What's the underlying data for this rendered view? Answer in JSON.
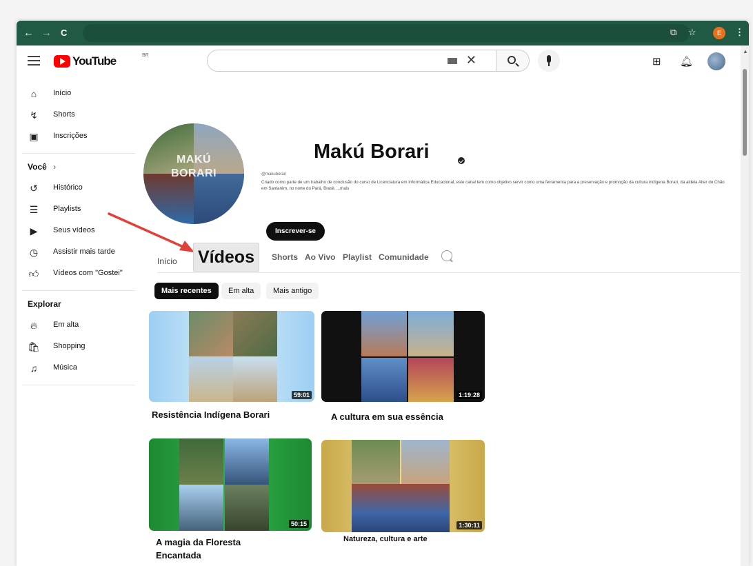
{
  "browser": {
    "back": "←",
    "forward": "→",
    "reload": "C",
    "profile_initial": "E"
  },
  "header": {
    "logo_text": "YouTube",
    "country_code": "BR",
    "search": {
      "value": "",
      "placeholder": ""
    }
  },
  "sidebar": {
    "main": [
      {
        "label": "Início",
        "icon": "home-icon"
      },
      {
        "label": "Shorts",
        "icon": "shorts-icon"
      },
      {
        "label": "Inscrições",
        "icon": "subscriptions-icon"
      }
    ],
    "voce_heading": "Você",
    "voce": [
      {
        "label": "Histórico",
        "icon": "history-icon"
      },
      {
        "label": "Playlists",
        "icon": "playlists-icon"
      },
      {
        "label": "Seus vídeos",
        "icon": "your-videos-icon"
      },
      {
        "label": "Assistir mais tarde",
        "icon": "watch-later-icon"
      },
      {
        "label": "Vídeos com \"Gostei\"",
        "icon": "liked-icon"
      }
    ],
    "explore_heading": "Explorar",
    "explore": [
      {
        "label": "Em alta",
        "icon": "trending-icon"
      },
      {
        "label": "Shopping",
        "icon": "shopping-icon"
      },
      {
        "label": "Música",
        "icon": "music-icon"
      }
    ]
  },
  "channel": {
    "name": "Makú Borari",
    "avatar_text_line1": "MAKÚ",
    "avatar_text_line2": "BORARI",
    "handle": "@makuborari",
    "description": "Criado como parte de um trabalho de conclusão do curso de Licenciatura em Informática Educacional, este canal tem como objetivo servir como uma ferramenta para a preservação e promoção da cultura indígena Borari, da aldeia Alter do Chão em Santarém, no norte do Pará, Brasil. ...mais",
    "subscribe_label": "Inscrever-se"
  },
  "tabs": [
    "Início",
    "Vídeos",
    "Shorts",
    "Ao Vivo",
    "Playlist",
    "Comunidade"
  ],
  "chips": [
    "Mais recentes",
    "Em alta",
    "Mais antigo"
  ],
  "videos": [
    {
      "title": "Resistência Indígena Borari",
      "duration": "59:01"
    },
    {
      "title": "A cultura em sua essência",
      "duration": "1:19:28"
    },
    {
      "title": "A magia da Floresta Encantada",
      "duration": "50:15"
    },
    {
      "title": "Natureza, cultura e arte",
      "duration": "1:30:11"
    }
  ],
  "colors": {
    "browser_bar": "#205a45",
    "youtube_red": "#ff0000",
    "annotation_arrow": "#e0413b"
  }
}
